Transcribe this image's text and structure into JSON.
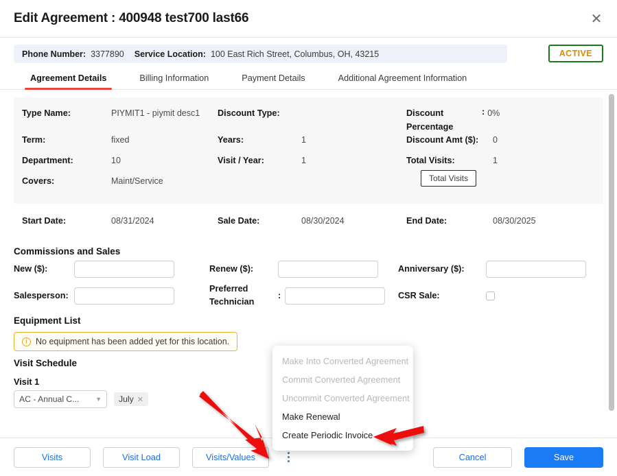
{
  "window": {
    "title": "Edit Agreement : 400948 test700 last66",
    "close_icon": "close-icon"
  },
  "info_bar": {
    "phone_label": "Phone Number:",
    "phone_value": "3377890",
    "location_label": "Service Location:",
    "location_value": "100 East Rich Street, Columbus, OH, 43215",
    "status": "ACTIVE",
    "status_border_color": "#1a7a1a",
    "status_text_color": "#d98c00"
  },
  "tabs": [
    {
      "label": "Agreement Details",
      "active": true
    },
    {
      "label": "Billing Information",
      "active": false
    },
    {
      "label": "Payment Details",
      "active": false
    },
    {
      "label": "Additional Agreement Information",
      "active": false
    }
  ],
  "details": {
    "type_name_label": "Type Name:",
    "type_name_value": "PIYMIT1 - piymit desc1",
    "discount_type_label": "Discount Type:",
    "discount_type_value": "",
    "discount_pct_label": "Discount Percentage",
    "discount_pct_value": "0%",
    "term_label": "Term:",
    "term_value": "fixed",
    "years_label": "Years:",
    "years_value": "1",
    "discount_amt_label": "Discount Amt ($):",
    "discount_amt_value": "0",
    "department_label": "Department:",
    "department_value": "10",
    "visit_year_label": "Visit / Year:",
    "visit_year_value": "1",
    "total_visits_label": "Total Visits:",
    "total_visits_value": "1",
    "covers_label": "Covers:",
    "covers_value": "Maint/Service",
    "tooltip": "Total Visits"
  },
  "dates": {
    "start_label": "Start Date:",
    "start_value": "08/31/2024",
    "sale_label": "Sale Date:",
    "sale_value": "08/30/2024",
    "end_label": "End Date:",
    "end_value": "08/30/2025"
  },
  "commissions": {
    "heading": "Commissions and Sales",
    "new_label": "New ($):",
    "new_value": "",
    "renew_label": "Renew ($):",
    "renew_value": "",
    "anniversary_label": "Anniversary ($):",
    "anniversary_value": "",
    "salesperson_label": "Salesperson:",
    "salesperson_value": "",
    "preferred_tech_label": "Preferred Technician",
    "preferred_tech_value": "",
    "csr_sale_label": "CSR Sale:",
    "csr_sale_checked": false
  },
  "equipment": {
    "heading": "Equipment List",
    "alert_icon": "info-circle-icon",
    "alert_text": "No equipment has been added yet for this location.",
    "alert_border_color": "#e8b423"
  },
  "visit_schedule": {
    "heading": "Visit Schedule",
    "visit_label": "Visit 1",
    "select_value": "AC - Annual C...",
    "chip_label": "July",
    "chip_remove_icon": "close-small-icon"
  },
  "context_menu": [
    {
      "label": "Make Into Converted Agreement",
      "disabled": true
    },
    {
      "label": "Commit Converted Agreement",
      "disabled": true
    },
    {
      "label": "Uncommit Converted Agreement",
      "disabled": true
    },
    {
      "label": "Make Renewal",
      "disabled": false
    },
    {
      "label": "Create Periodic Invoice",
      "disabled": false
    }
  ],
  "footer": {
    "visits": "Visits",
    "visit_load": "Visit Load",
    "visits_values": "Visits/Values",
    "kebab_icon": "kebab-menu-icon",
    "cancel": "Cancel",
    "save": "Save",
    "save_color": "#1a7cf5"
  },
  "annotations": {
    "arrow_color": "#ee1111",
    "arrow_1_target": "kebab-menu-icon",
    "arrow_2_target": "create-periodic-invoice"
  }
}
